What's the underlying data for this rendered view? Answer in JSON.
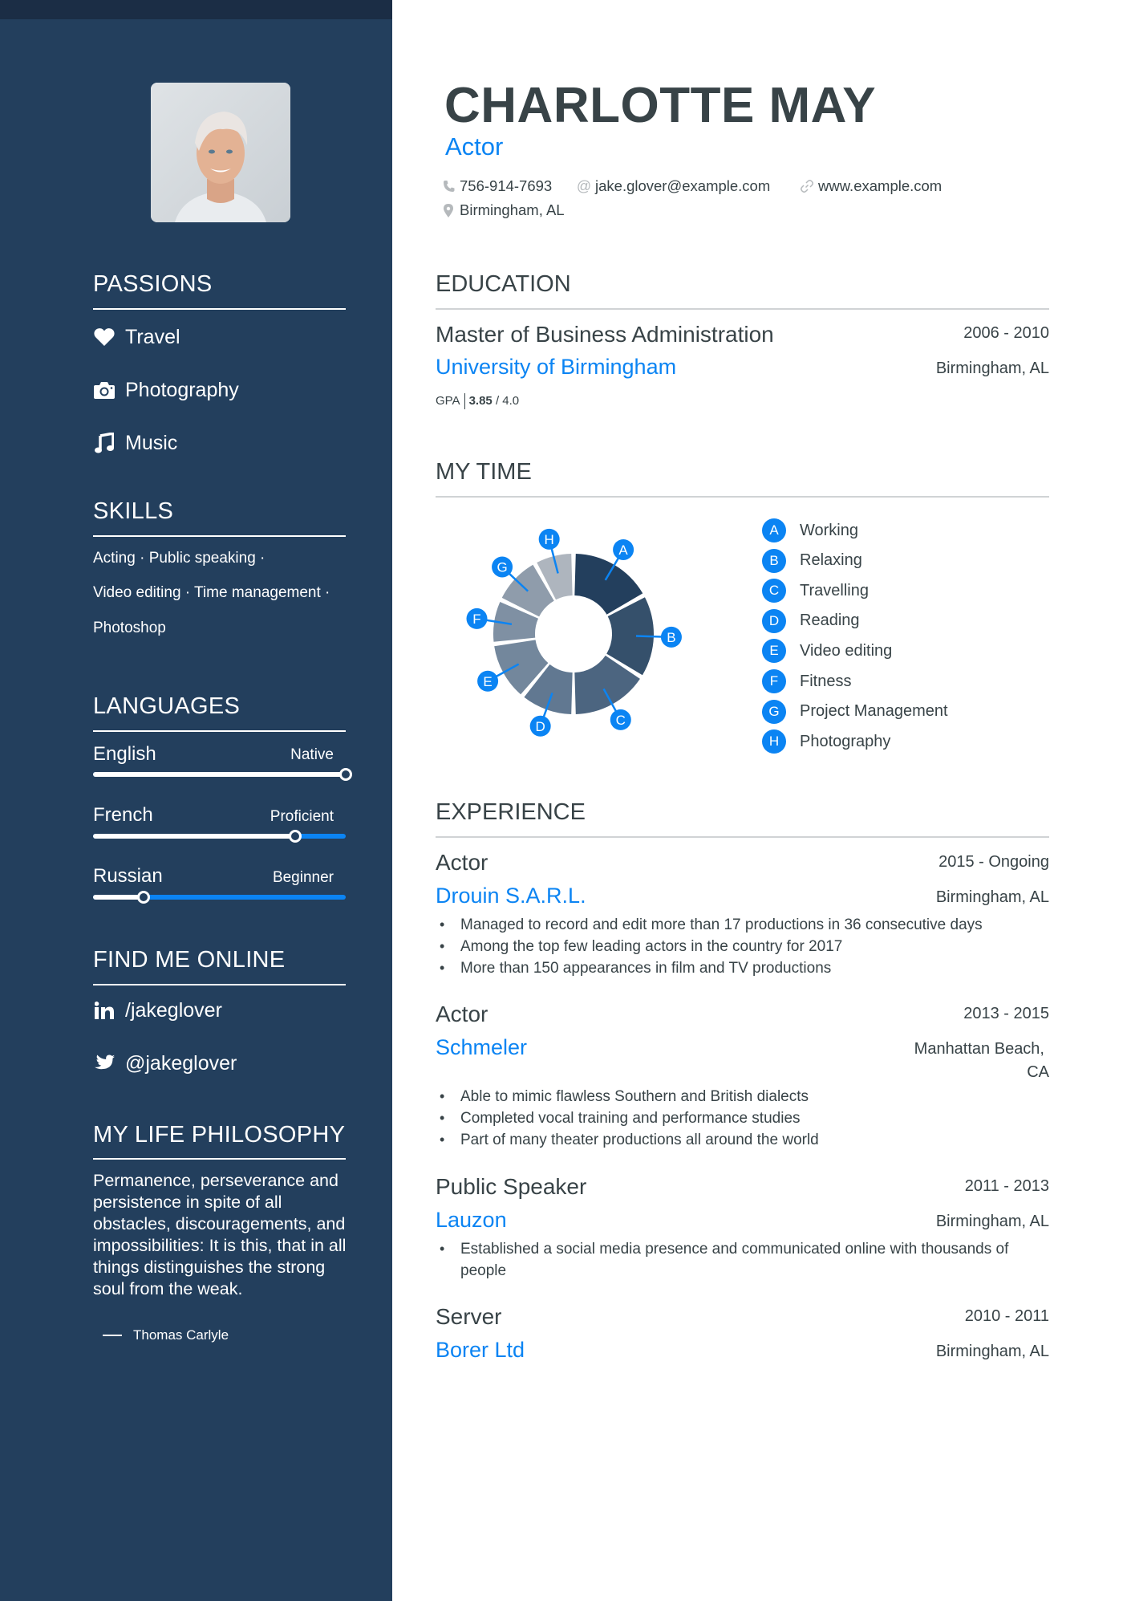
{
  "profile": {
    "name": "CHARLOTTE MAY",
    "title": "Actor",
    "phone": "756-914-7693",
    "email": "jake.glover@example.com",
    "website": "www.example.com",
    "location": "Birmingham, AL"
  },
  "sidebar": {
    "passions": {
      "heading": "PASSIONS",
      "items": [
        {
          "label": "Travel",
          "icon": "heart-icon"
        },
        {
          "label": "Photography",
          "icon": "camera-icon"
        },
        {
          "label": "Music",
          "icon": "music-icon"
        }
      ]
    },
    "skills": {
      "heading": "SKILLS",
      "lines": [
        "Acting · Public speaking ·",
        "Video editing · Time management ·",
        "Photoshop"
      ]
    },
    "languages": {
      "heading": "LANGUAGES",
      "items": [
        {
          "name": "English",
          "level": "Native",
          "proficiency": 1.0
        },
        {
          "name": "French",
          "level": "Proficient",
          "proficiency": 0.8
        },
        {
          "name": "Russian",
          "level": "Beginner",
          "proficiency": 0.2
        }
      ]
    },
    "online": {
      "heading": "FIND ME ONLINE",
      "items": [
        {
          "label": "/jakeglover",
          "icon": "linkedin-icon"
        },
        {
          "label": "@jakeglover",
          "icon": "twitter-icon"
        }
      ]
    },
    "philosophy": {
      "heading": "MY LIFE PHILOSOPHY",
      "quote": "Permanence, perseverance and persistence in spite of all obstacles, discouragements, and impossibilities: It is this, that in all things distinguishes the strong soul from the weak.",
      "author": "Thomas Carlyle"
    }
  },
  "education": {
    "heading": "EDUCATION",
    "items": [
      {
        "degree": "Master of Business Administration",
        "dates": "2006 - 2010",
        "school": "University of Birmingham",
        "location": "Birmingham, AL",
        "gpa_label": "GPA",
        "gpa_value": "3.85",
        "gpa_max": "/ 4.0"
      }
    ]
  },
  "my_time": {
    "heading": "MY TIME"
  },
  "chart_data": {
    "type": "pie",
    "variant": "donut",
    "title": "MY TIME",
    "categories": [
      "Working",
      "Relaxing",
      "Travelling",
      "Reading",
      "Video editing",
      "Fitness",
      "Project Management",
      "Photography"
    ],
    "letters": [
      "A",
      "B",
      "C",
      "D",
      "E",
      "F",
      "G",
      "H"
    ],
    "values": [
      17,
      17,
      16,
      11,
      12,
      9,
      10,
      8
    ],
    "unit": "percent (estimated from slice angles)",
    "colors": [
      "#233f5d",
      "#35506b",
      "#4c6580",
      "#617891",
      "#73879c",
      "#7f90a3",
      "#8f9cab",
      "#aeb5be"
    ],
    "badge_color": "#0b84f3",
    "legend_position": "right"
  },
  "experience": {
    "heading": "EXPERIENCE",
    "items": [
      {
        "role": "Actor",
        "dates": "2015 - Ongoing",
        "company": "Drouin S.A.R.L.",
        "location": "Birmingham, AL",
        "bullets": [
          "Managed to record and edit more than 17 productions in 36 consecutive days",
          "Among the top few leading actors in the country for 2017",
          "More than 150 appearances in film and TV productions"
        ]
      },
      {
        "role": "Actor",
        "dates": "2013 - 2015",
        "company": "Schmeler",
        "location_line1": "Manhattan Beach,",
        "location_line2": "CA",
        "bullets": [
          "Able to mimic flawless Southern and British dialects",
          "Completed vocal training and performance studies",
          "Part of many theater productions all around the world"
        ]
      },
      {
        "role": "Public Speaker",
        "dates": "2011 - 2013",
        "company": "Lauzon",
        "location": "Birmingham, AL",
        "bullets": [
          "Established a social media presence and communicated online with thousands of people"
        ]
      },
      {
        "role": "Server",
        "dates": "2010 - 2011",
        "company": "Borer Ltd",
        "location": "Birmingham, AL",
        "bullets": []
      }
    ]
  },
  "colors": {
    "sidebar": "#233f5d",
    "topband": "#1b2d45",
    "accent": "#0b84f3",
    "text": "#384347"
  }
}
